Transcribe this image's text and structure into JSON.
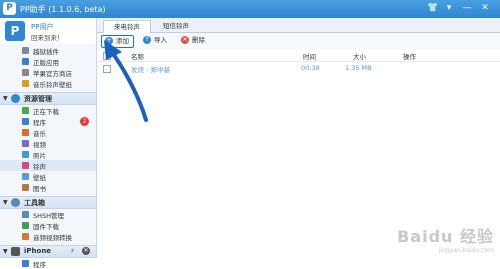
{
  "app": {
    "title": "PP助手 (1.1.0.6, beta)",
    "logo_char": "P"
  },
  "window_controls": {
    "skin": "👕",
    "menu": "▾",
    "minimize": "—",
    "close": "✕"
  },
  "user": {
    "name": "PP用户",
    "greeting": "回来到来！",
    "avatar_char": "P"
  },
  "sidebar": {
    "top_items": [
      {
        "label": "越狱插件",
        "color": "#7a8a9a"
      },
      {
        "label": "正版应用",
        "color": "#3b7fd0"
      },
      {
        "label": "苹果官方商店",
        "color": "#8a8a8a"
      },
      {
        "label": "音乐铃声壁纸",
        "color": "#d8a020"
      }
    ],
    "resource_section": "资源管理",
    "resource_items": [
      {
        "label": "正在下载",
        "color": "#4aa84a"
      },
      {
        "label": "程序",
        "color": "#3b7fd0",
        "badge": "2"
      },
      {
        "label": "音乐",
        "color": "#e06a2a"
      },
      {
        "label": "视频",
        "color": "#7a6ad0"
      },
      {
        "label": "照片",
        "color": "#3aa0c8"
      },
      {
        "label": "铃声",
        "color": "#d04a7a"
      },
      {
        "label": "壁纸",
        "color": "#5a9ae0"
      },
      {
        "label": "图书",
        "color": "#b07a3a"
      }
    ],
    "toolbox_section": "工具箱",
    "toolbox_items": [
      {
        "label": "SHSH管理",
        "color": "#5a8ab0"
      },
      {
        "label": "固件下载",
        "color": "#4a9a5a"
      },
      {
        "label": "音频视频转换",
        "color": "#d07a3a"
      }
    ],
    "device_section": "iPhone",
    "device_items": [
      {
        "label": "程序",
        "color": "#3b7fd0"
      }
    ]
  },
  "tabs": [
    {
      "label": "来电铃声",
      "active": true
    },
    {
      "label": "短信铃声",
      "active": false
    }
  ],
  "toolbar": {
    "add_label": "添加",
    "import_label": "导入",
    "delete_label": "删除",
    "add_icon": "+",
    "import_icon": "↑",
    "delete_icon": "✕"
  },
  "table": {
    "headers": {
      "name": "名称",
      "time": "时间",
      "size": "大小",
      "action": "操作"
    },
    "rows": [
      {
        "name": "发烧 - 郑中基",
        "time": "00:38",
        "size": "1.35 MB",
        "action": ""
      }
    ]
  },
  "watermark": {
    "brand": "Baidu 经验",
    "url": "jingyan.baidu.com"
  }
}
